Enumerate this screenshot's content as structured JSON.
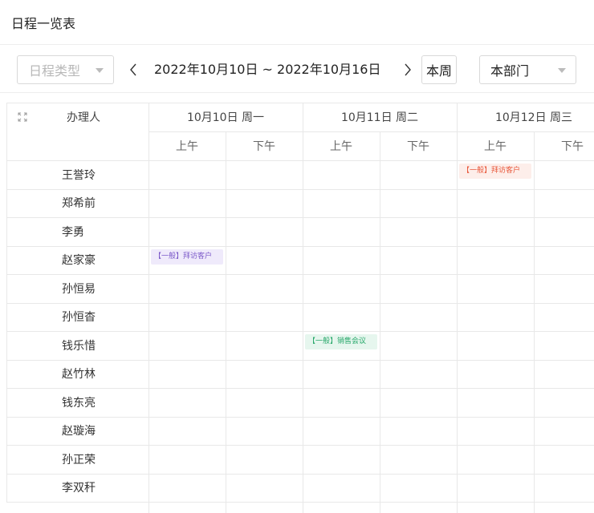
{
  "header": {
    "title": "日程一览表"
  },
  "toolbar": {
    "type_placeholder": "日程类型",
    "date_range": "2022年10月10日 ~ 2022年10月16日",
    "this_week_label": "本周",
    "department_value": "本部门"
  },
  "table": {
    "assignee_header": "办理人",
    "days": [
      {
        "label": "10月10日 周一",
        "am": "上午",
        "pm": "下午"
      },
      {
        "label": "10月11日 周二",
        "am": "上午",
        "pm": "下午"
      },
      {
        "label": "10月12日 周三",
        "am": "上午",
        "pm": "下午"
      }
    ],
    "rows": [
      {
        "name": "王誉玲"
      },
      {
        "name": "郑希前"
      },
      {
        "name": "李勇"
      },
      {
        "name": "赵家豪"
      },
      {
        "name": "孙恒易"
      },
      {
        "name": "孙恒杳"
      },
      {
        "name": "钱乐惜"
      },
      {
        "name": "赵竹林"
      },
      {
        "name": "钱东亮"
      },
      {
        "name": "赵璇海"
      },
      {
        "name": "孙正荣"
      },
      {
        "name": "李双秆"
      }
    ],
    "events": [
      {
        "row": 0,
        "day": 2,
        "half": "am",
        "text": "【一般】拜访客户",
        "color": "#e8573a",
        "bg": "#fdeeea"
      },
      {
        "row": 3,
        "day": 0,
        "half": "am",
        "text": "【一般】拜访客户",
        "color": "#7b59c9",
        "bg": "#efeafb"
      },
      {
        "row": 6,
        "day": 1,
        "half": "am",
        "text": "【一般】销售会议",
        "color": "#27a86a",
        "bg": "#e6f6ee"
      }
    ]
  },
  "colors": {
    "border": "#e8e8e8",
    "placeholder": "#b8b8b8"
  }
}
